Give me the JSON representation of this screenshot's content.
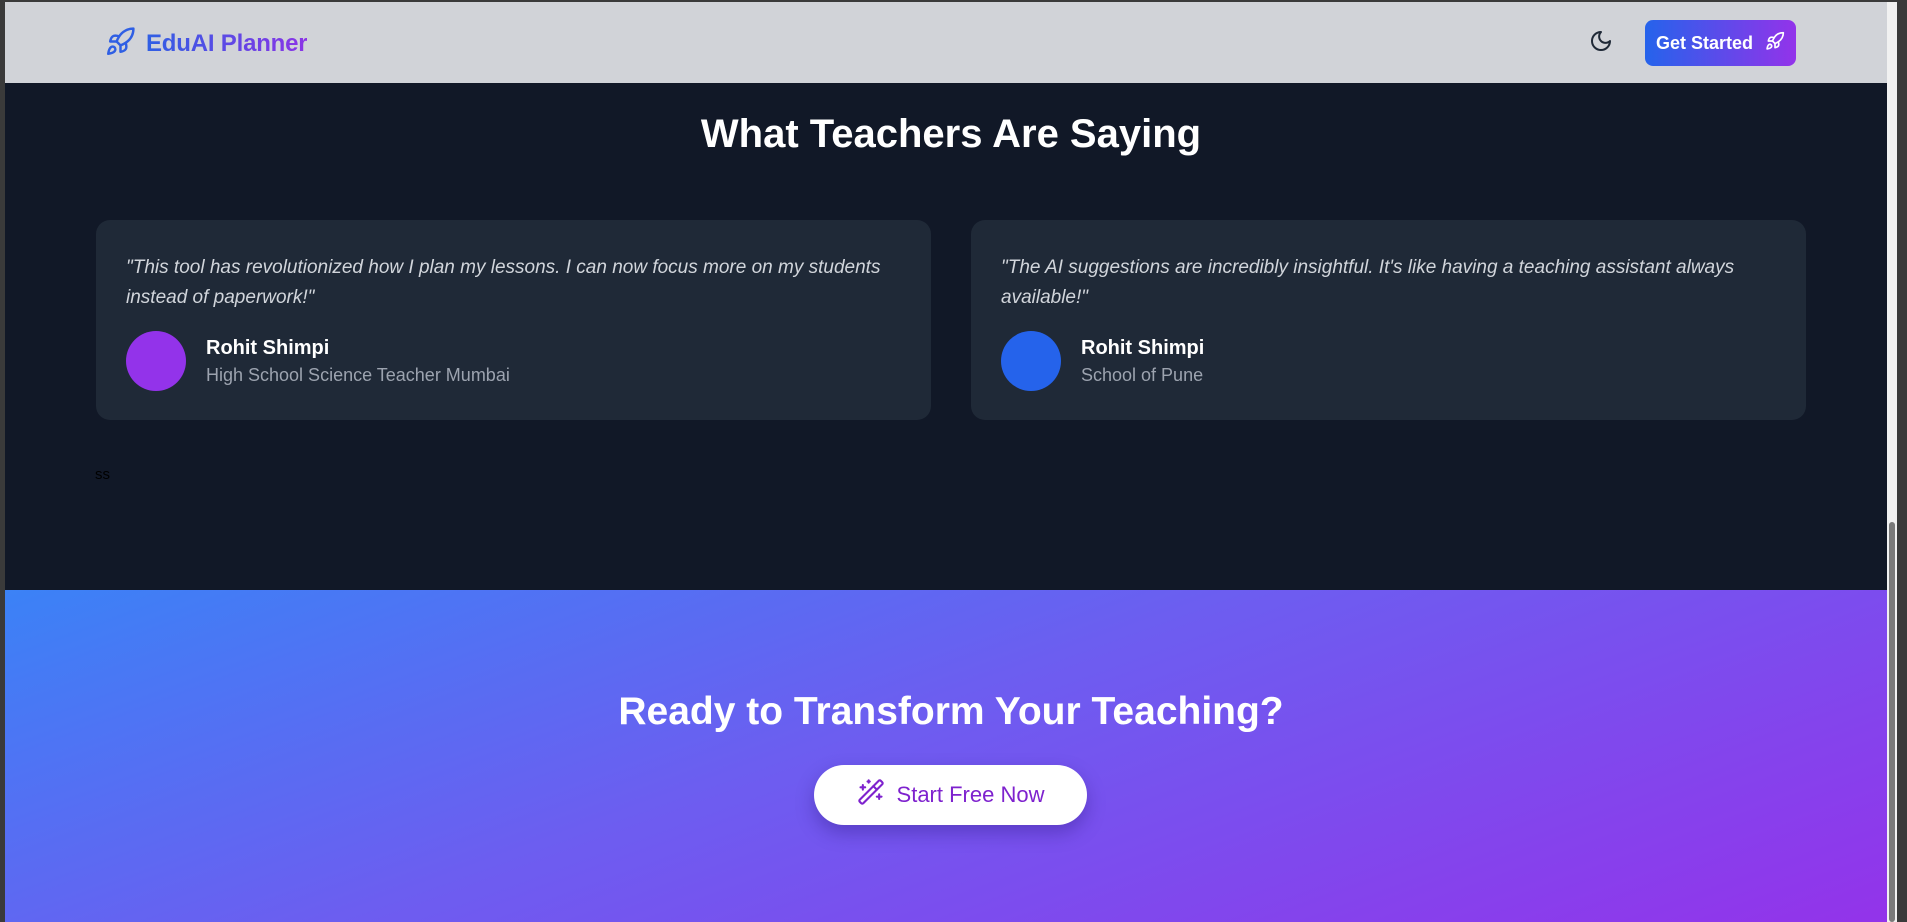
{
  "navbar": {
    "brand_name": "EduAI Planner",
    "brand_icon": "rocket-icon",
    "theme_icon": "moon-icon",
    "cta_label": "Get Started",
    "cta_icon": "rocket-icon"
  },
  "testimonials": {
    "title": "What Teachers Are Saying",
    "items": [
      {
        "quote": "\"This tool has revolutionized how I plan my lessons. I can now focus more on my students instead of paperwork!\"",
        "name": "Rohit Shimpi",
        "role": "High School Science Teacher Mumbai",
        "avatar_color": "#9333ea"
      },
      {
        "quote": "\"The AI suggestions are incredibly insightful. It's like having a teaching assistant always available!\"",
        "name": "Rohit Shimpi",
        "role": "School of Pune",
        "avatar_color": "#2563eb"
      }
    ],
    "stray_text": "ss"
  },
  "cta": {
    "title": "Ready to Transform Your Teaching?",
    "button_label": "Start Free Now",
    "button_icon": "magic-wand-icon"
  },
  "colors": {
    "page_bg": "#111827",
    "card_bg": "#1f2937",
    "brand_gradient_start": "#2563eb",
    "brand_gradient_end": "#9333ea"
  }
}
